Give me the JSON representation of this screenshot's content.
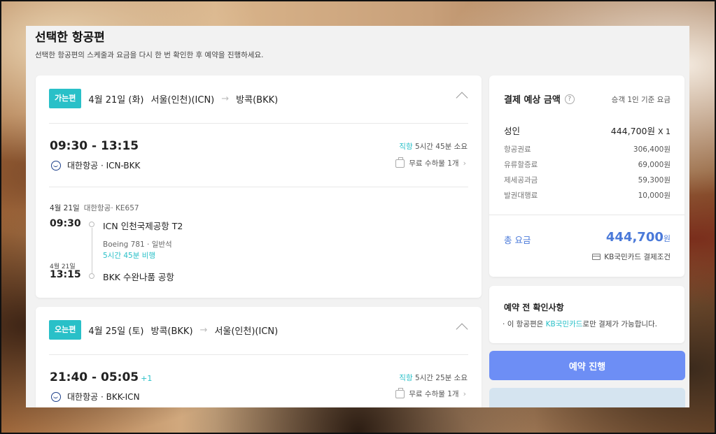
{
  "page": {
    "title": "선택한 항공편",
    "subtitle": "선택한 항공편의 스케줄과 요금을 다시 한 번 확인한 후 예약을 진행하세요."
  },
  "outbound": {
    "badge": "가는편",
    "date": "4월 21일 (화)",
    "origin": "서울(인천)(ICN)",
    "arrow": "→",
    "destination": "방콕(BKK)",
    "times": "09:30 - 13:15",
    "airline_line": "대한항공 · ICN-BKK",
    "direct_label": "직항",
    "duration_text": "5시간 45분 소요",
    "baggage": "무료 수하물 1개",
    "segment": {
      "date": "4월 21일",
      "flight": "대한항공· KE657",
      "dep_time": "09:30",
      "dep_airport": "ICN 인천국제공항 T2",
      "aircraft": "Boeing 781 · 일반석",
      "flight_duration": "5시간 45분 비행",
      "arr_date": "4월 21일",
      "arr_time": "13:15",
      "arr_airport": "BKK 수완나품 공항"
    }
  },
  "inbound": {
    "badge": "오는편",
    "date": "4월 25일 (토)",
    "origin": "방콕(BKK)",
    "arrow": "→",
    "destination": "서울(인천)(ICN)",
    "times": "21:40 - 05:05",
    "day_offset": "+1",
    "airline_line": "대한항공 · BKK-ICN",
    "direct_label": "직항",
    "duration_text": "5시간 25분 소요",
    "baggage": "무료 수하물 1개"
  },
  "price": {
    "title": "결제 예상 금액",
    "help_icon": "?",
    "basis": "승객 1인 기준 요금",
    "adult_label": "성인",
    "adult_value": "444,700원",
    "adult_count": "X 1",
    "breakdown": [
      {
        "label": "항공권료",
        "value": "306,400원"
      },
      {
        "label": "유류할증료",
        "value": "69,000원"
      },
      {
        "label": "제세공과금",
        "value": "59,300원"
      },
      {
        "label": "발권대행료",
        "value": "10,000원"
      }
    ],
    "total_label": "총 요금",
    "total_value": "444,700",
    "total_unit": "원",
    "card_condition": "KB국민카드 결제조건"
  },
  "notice": {
    "title": "예약 전 확인사항",
    "bullet": "·",
    "text_before": "이 항공편은 ",
    "text_highlight": "KB국민카드",
    "text_after": "로만 결제가 가능합니다."
  },
  "reserve_button": "예약 진행",
  "colors": {
    "teal": "#29c0c8",
    "blue": "#4a79d9",
    "button": "#6d8ef5"
  }
}
